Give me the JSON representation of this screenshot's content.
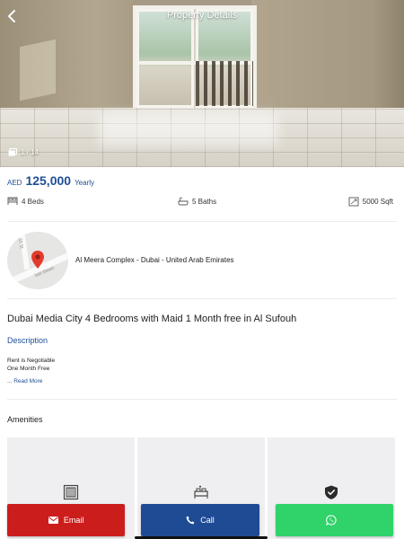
{
  "header": {
    "title": "Property Details",
    "photo_counter": "1 / 14"
  },
  "price": {
    "currency": "AED",
    "amount": "125,000",
    "period": "Yearly"
  },
  "specs": {
    "beds": "4 Beds",
    "baths": "5 Baths",
    "area": "5000 Sqft"
  },
  "location": {
    "address": "Al Meera Complex - Dubai - United Arab Emirates",
    "map_street_1": "340 Street",
    "map_street_2": "33 St"
  },
  "listing": {
    "title": "Dubai Media City  4 Bedrooms with Maid  1 Month free in Al Sufouh",
    "description_heading": "Description",
    "description_lines": [
      "Rent is Negotiable",
      "One Month Free"
    ],
    "read_more": "... Read More"
  },
  "amenities": {
    "heading": "Amenities",
    "items": [
      {
        "icon": "building-icon"
      },
      {
        "icon": "bed-icon"
      },
      {
        "icon": "shield-check-icon"
      }
    ]
  },
  "actions": {
    "email_label": "Email",
    "call_label": "Call",
    "whatsapp_label": ""
  },
  "colors": {
    "accent_blue": "#1f4e96",
    "email_red": "#cc1d1d",
    "call_blue": "#1e4b94",
    "whatsapp_green": "#2fd36a"
  }
}
